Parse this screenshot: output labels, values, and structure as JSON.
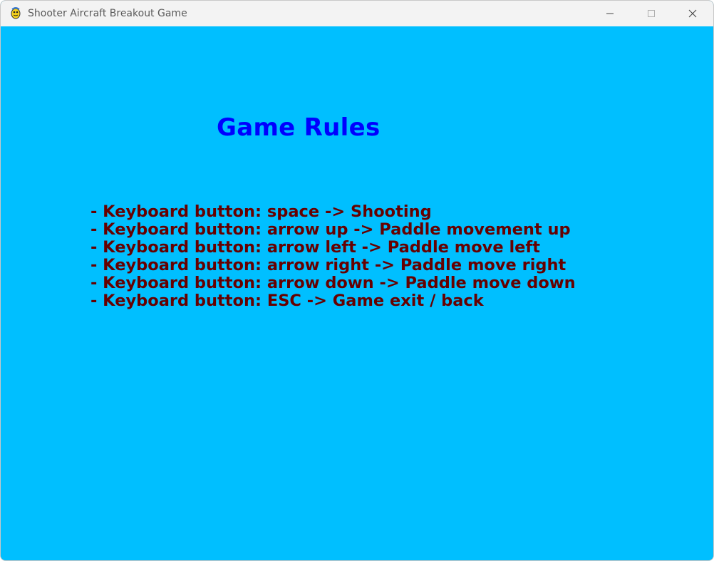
{
  "window": {
    "title": "Shooter Aircraft Breakout Game",
    "icon": "pygame-snake-icon",
    "controls": {
      "minimize": "minimize-icon",
      "maximize": "maximize-icon",
      "close": "close-icon"
    }
  },
  "colors": {
    "background": "#00bfff",
    "title": "#0000ff",
    "rule_text": "#660000"
  },
  "screen": {
    "title": "Game Rules",
    "rules": [
      "- Keyboard button: space -> Shooting",
      "- Keyboard button: arrow up -> Paddle movement up",
      "- Keyboard button: arrow left -> Paddle move left",
      "- Keyboard button: arrow right -> Paddle move right",
      "- Keyboard button: arrow down -> Paddle move down",
      "- Keyboard button: ESC -> Game exit / back"
    ]
  }
}
